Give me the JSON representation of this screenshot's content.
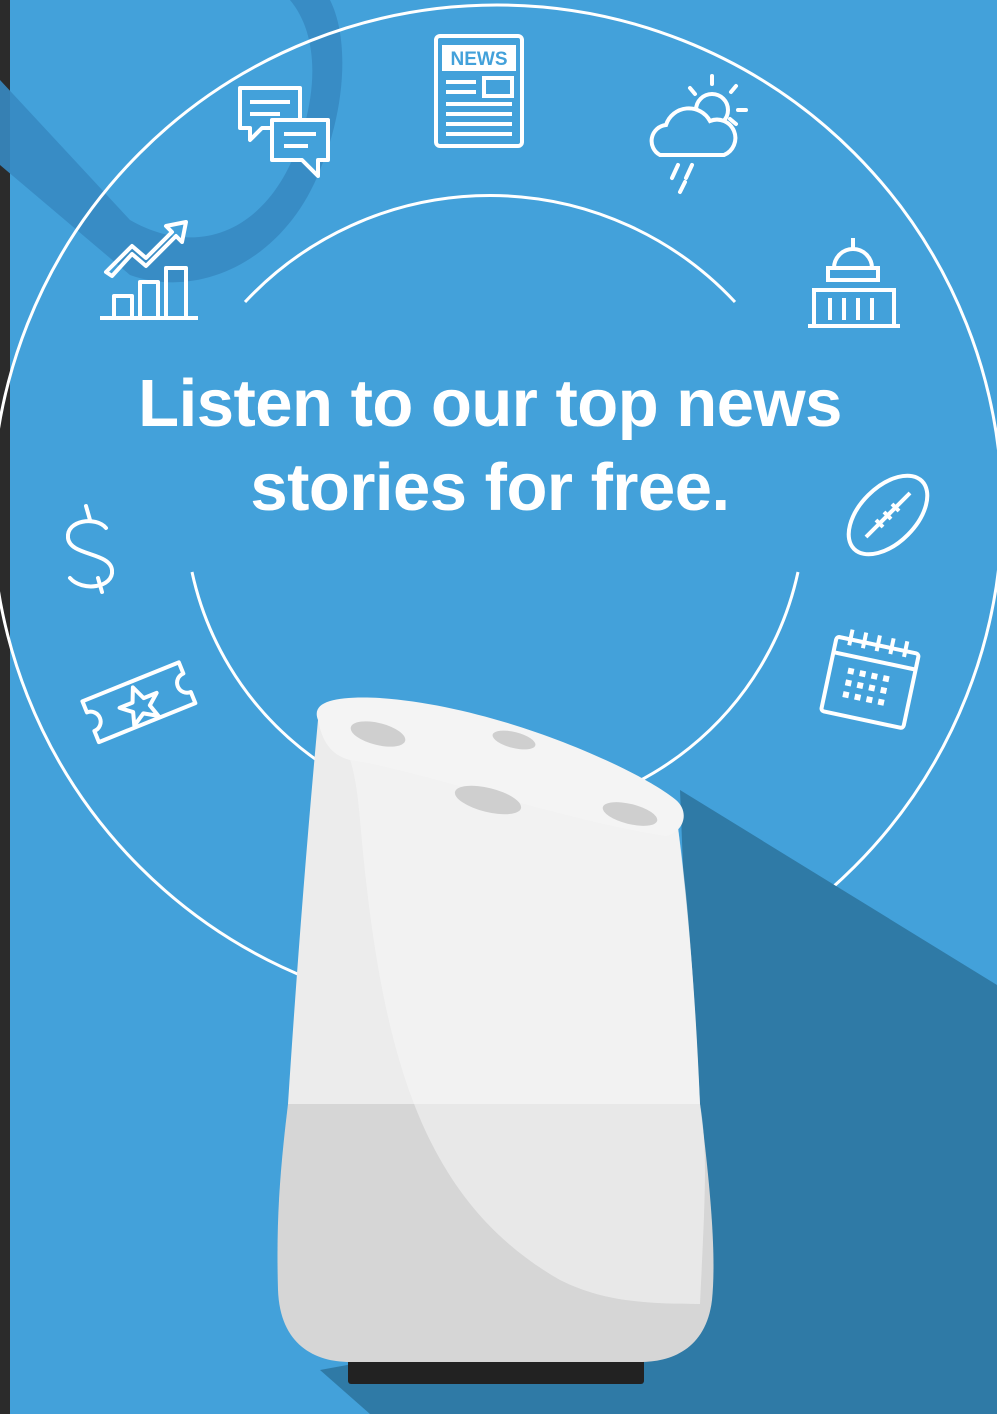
{
  "headline": {
    "line1": "Listen to our top news",
    "line2": "stories for free."
  },
  "newspaper_icon": {
    "label": "NEWS"
  },
  "icons": [
    "chat-bubbles-icon",
    "newspaper-icon",
    "weather-icon",
    "rising-chart-icon",
    "capitol-building-icon",
    "dollar-sign-icon",
    "football-icon",
    "ticket-star-icon",
    "calendar-icon",
    "smart-speaker"
  ],
  "colors": {
    "background": "#43a1da",
    "shadow": "#2f7aa6",
    "ring": "#ffffff",
    "speaker_top": "#f2f2f2",
    "speaker_base": "#222222"
  }
}
